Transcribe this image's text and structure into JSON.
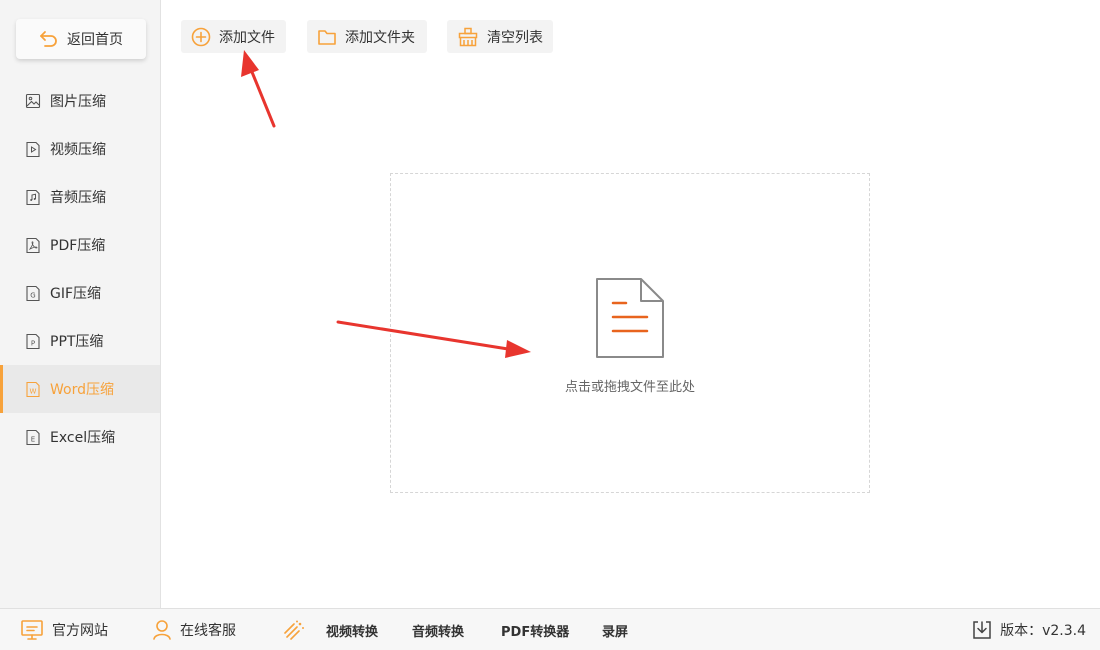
{
  "sidebar": {
    "back_label": "返回首页",
    "items": [
      {
        "label": "图片压缩",
        "icon": "image-icon",
        "active": false
      },
      {
        "label": "视频压缩",
        "icon": "video-file-icon",
        "active": false
      },
      {
        "label": "音频压缩",
        "icon": "audio-file-icon",
        "active": false
      },
      {
        "label": "PDF压缩",
        "icon": "pdf-file-icon",
        "active": false
      },
      {
        "label": "GIF压缩",
        "icon": "gif-file-icon",
        "active": false
      },
      {
        "label": "PPT压缩",
        "icon": "ppt-file-icon",
        "active": false
      },
      {
        "label": "Word压缩",
        "icon": "word-file-icon",
        "active": true
      },
      {
        "label": "Excel压缩",
        "icon": "excel-file-icon",
        "active": false
      }
    ]
  },
  "toolbar": {
    "add_file_label": "添加文件",
    "add_folder_label": "添加文件夹",
    "clear_list_label": "清空列表"
  },
  "dropzone": {
    "text": "点击或拖拽文件至此处"
  },
  "footer": {
    "website_label": "官方网站",
    "support_label": "在线客服",
    "links": [
      "视频转换",
      "音频转换",
      "PDF转换器",
      "录屏"
    ],
    "version_label": "版本：v2.3.4"
  },
  "colors": {
    "accent": "#f7a23b",
    "doc_lines": "#e8641e",
    "annotation_arrow": "#e8352e"
  }
}
